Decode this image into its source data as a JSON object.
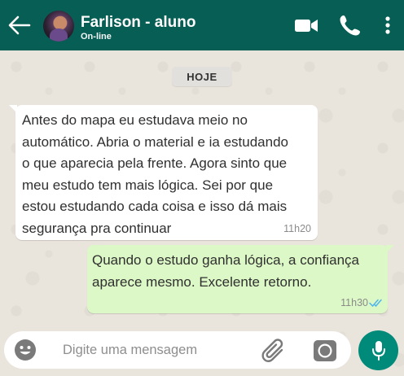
{
  "header": {
    "contact_name": "Farlison - aluno",
    "status": "On-line",
    "back_icon": "arrow-left-icon",
    "video_icon": "video-camera-icon",
    "call_icon": "phone-icon",
    "menu_icon": "vertical-dots-icon",
    "color": "#075e54"
  },
  "chat": {
    "date_label": "HOJE",
    "messages": [
      {
        "direction": "incoming",
        "lines": [
          "Antes do mapa eu estudava meio no",
          "automático. Abria o material e ia estudando",
          "o que aparecia pela frente. Agora sinto que",
          "meu estudo tem mais lógica. Sei por que",
          "estou estudando cada coisa e isso dá mais",
          "segurança pra continuar"
        ],
        "time": "11h20",
        "bubble_color": "#ffffff"
      },
      {
        "direction": "outgoing",
        "lines": [
          "Quando o estudo ganha lógica, a confiança",
          "aparece mesmo. Excelente retorno."
        ],
        "time": "11h30",
        "status_icon": "double-check-read-icon",
        "bubble_color": "#dcf8c6"
      }
    ]
  },
  "composer": {
    "placeholder": "Digite uma mensagem",
    "emoji_icon": "emoji-icon",
    "attach_icon": "paperclip-icon",
    "camera_icon": "camera-icon",
    "mic_icon": "microphone-icon",
    "mic_color": "#008a7a"
  }
}
